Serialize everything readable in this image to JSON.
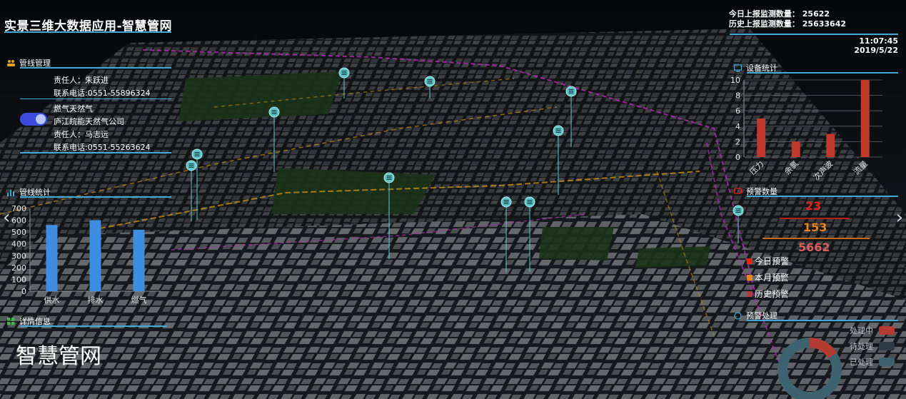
{
  "app": {
    "title": "实景三维大数据应用-智慧管网",
    "brand_text": "智慧管网"
  },
  "stats": {
    "today_label": "今日上报监测数量：",
    "today_value": "25622",
    "history_label": "历史上报监测数量：",
    "history_value": "25633642"
  },
  "clock": {
    "time": "11:07:45",
    "date": "2019/5/22"
  },
  "pipeline_mgmt": {
    "header": "管线管理",
    "responsible1": "责任人：朱跃进",
    "phone1": "联系电话:0551-55896324",
    "toggle_label": "燃气天然气",
    "company": "庐江皖能天然气公司",
    "responsible2": "责任人：马志远",
    "phone2": "联系电话:0551-55263624",
    "toggle_on": true
  },
  "pipeline_stats": {
    "header": "管线统计",
    "chart_data": {
      "type": "bar",
      "categories": [
        "供水",
        "排水",
        "燃气"
      ],
      "values": [
        560,
        600,
        520
      ],
      "ylim": [
        0,
        700
      ],
      "yticks": [
        0,
        100,
        200,
        300,
        400,
        500,
        600,
        700
      ],
      "color": "#3d8ee0"
    }
  },
  "detail": {
    "header": "详情信息"
  },
  "device_stats": {
    "header": "设备统计",
    "chart_data": {
      "type": "bar",
      "categories": [
        "压力",
        "余氯",
        "次声波",
        "流量"
      ],
      "values": [
        5,
        2,
        3,
        10
      ],
      "ylim": [
        0,
        10
      ],
      "yticks": [
        0,
        2,
        4,
        6,
        8,
        10
      ],
      "color": "#c0392b"
    }
  },
  "warning_count": {
    "header": "预警数量",
    "today": "23",
    "month": "153",
    "history": "5662",
    "legend": [
      {
        "label": "今日预警",
        "color": "#e0241b"
      },
      {
        "label": "本月预警",
        "color": "#e8841a"
      },
      {
        "label": "历史预警",
        "color": "#b23b3b"
      }
    ]
  },
  "warning_handling": {
    "header": "预警处理",
    "legend": [
      {
        "label": "处理中",
        "color": "#b43b32"
      },
      {
        "label": "待处理",
        "color": "#2d3a45"
      },
      {
        "label": "已处理",
        "color": "#3e6270"
      }
    ]
  },
  "nav": {
    "left": "‹",
    "right": "›"
  },
  "colors": {
    "accent": "#3fa9d8"
  }
}
